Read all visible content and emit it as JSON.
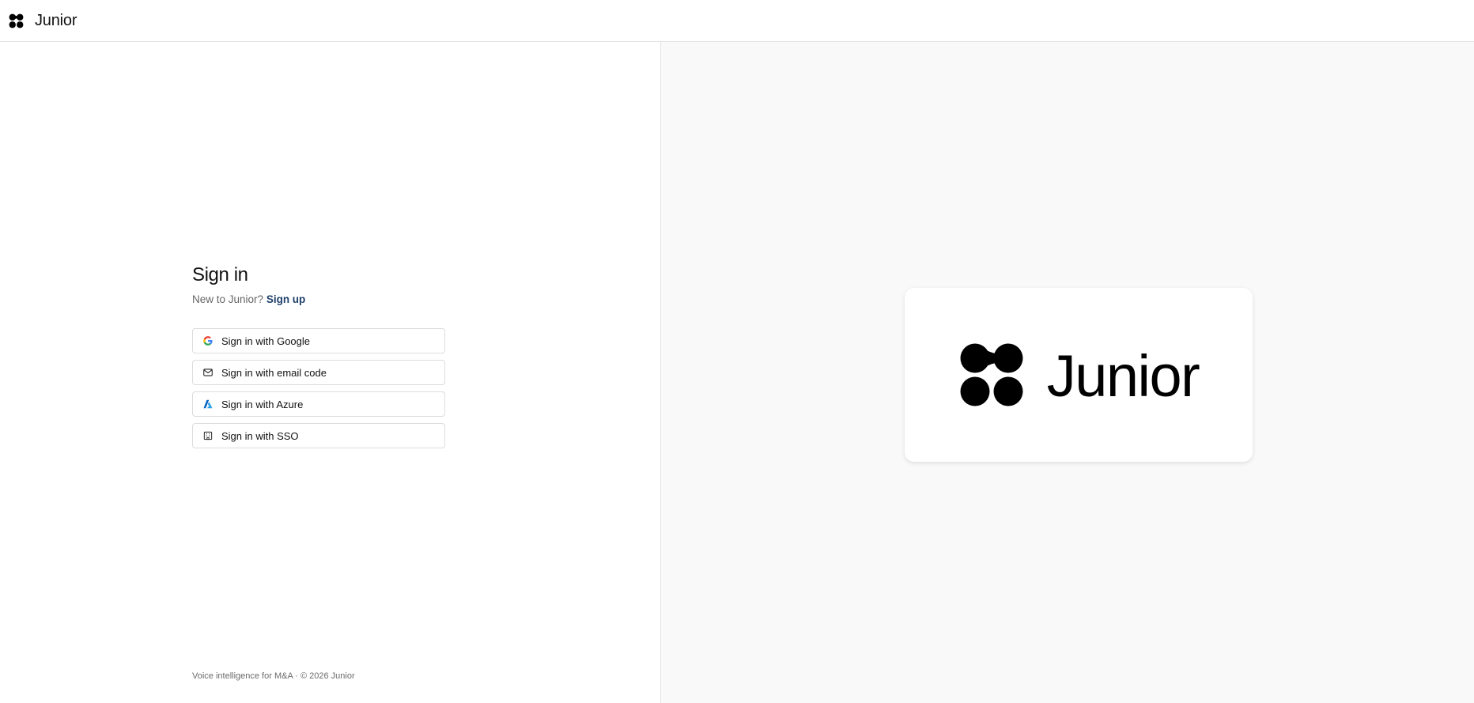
{
  "header": {
    "brand_name": "Junior",
    "brand_icon": "junior-logo-mark"
  },
  "signin": {
    "title": "Sign in",
    "new_prompt": "New to Junior?",
    "signup_label": "Sign up",
    "providers": [
      {
        "label": "Sign in with Google",
        "icon": "google-icon"
      },
      {
        "label": "Sign in with email code",
        "icon": "envelope-icon"
      },
      {
        "label": "Sign in with Azure",
        "icon": "azure-icon"
      },
      {
        "label": "Sign in with SSO",
        "icon": "building-icon"
      }
    ]
  },
  "footer": {
    "text": "Voice intelligence for M&A · © 2026 Junior"
  },
  "showcase": {
    "brand_name": "Junior",
    "brand_icon": "junior-logo-mark"
  },
  "colors": {
    "link": "#1f3f6a",
    "border": "#dcdcdc",
    "right_bg": "#f9f9f9"
  }
}
